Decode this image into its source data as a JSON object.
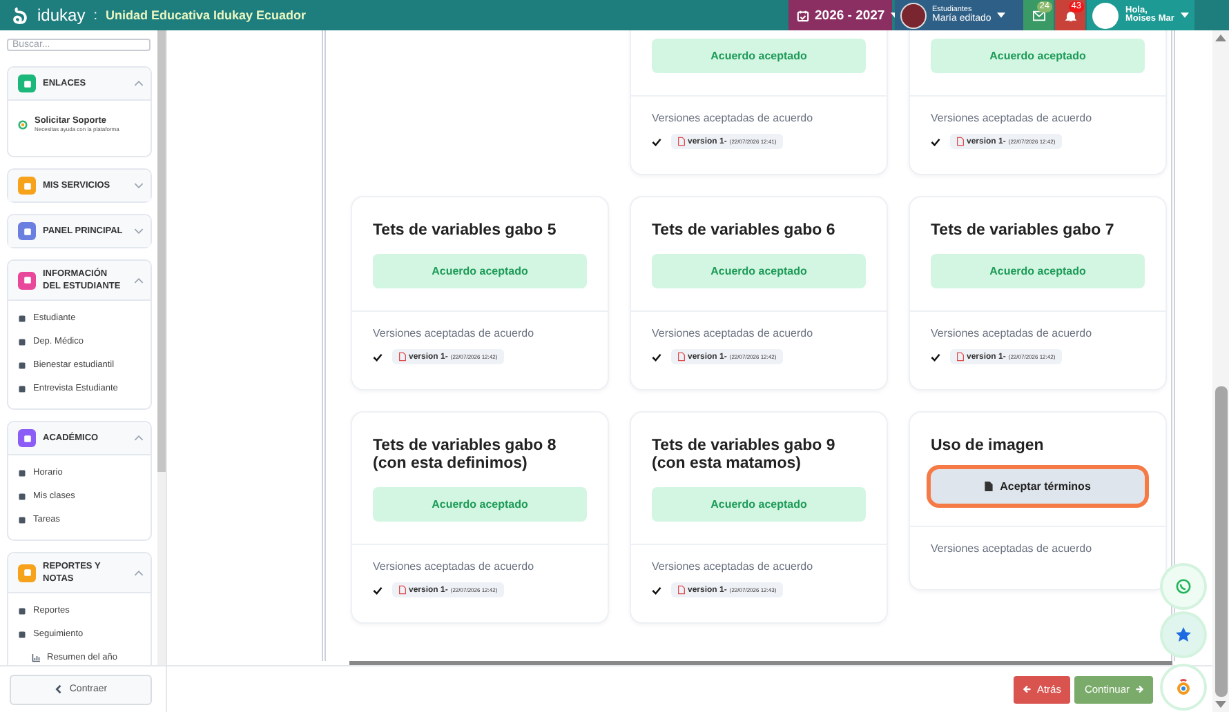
{
  "topbar": {
    "brand": "idukay",
    "separator": ":",
    "school": "Unidad Educativa Idukay Ecuador",
    "year": "2026 - 2027",
    "profile": {
      "role": "Estudiantes",
      "name": "María editado"
    },
    "messages_count": "24",
    "notifications_count": "43",
    "greeting": "Hola,",
    "user": "Moises Mar"
  },
  "sidebar": {
    "search_placeholder": "Buscar...",
    "sections": [
      {
        "title": "ENLACES",
        "color": "#1cb77a",
        "expanded": true,
        "items": [
          {
            "label": "Solicitar Soporte",
            "description": "Necesitas ayuda con la plataforma"
          }
        ]
      },
      {
        "title": "MIS SERVICIOS",
        "color": "#f7a21b",
        "expanded": false
      },
      {
        "title": "PANEL PRINCIPAL",
        "color": "#6a7fe0",
        "expanded": false
      },
      {
        "title": "INFORMACIÓN DEL ESTUDIANTE",
        "color": "#e8479a",
        "expanded": true,
        "items": [
          {
            "label": "Estudiante"
          },
          {
            "label": "Dep. Médico"
          },
          {
            "label": "Bienestar estudiantil"
          },
          {
            "label": "Entrevista Estudiante"
          }
        ]
      },
      {
        "title": "ACADÉMICO",
        "color": "#8b5cf6",
        "expanded": true,
        "items": [
          {
            "label": "Horario"
          },
          {
            "label": "Mis clases"
          },
          {
            "label": "Tareas"
          }
        ]
      },
      {
        "title": "REPORTES Y NOTAS",
        "color": "#f7a21b",
        "expanded": true,
        "items": [
          {
            "label": "Reportes"
          },
          {
            "label": "Seguimiento",
            "children": [
              {
                "label": "Resumen del año"
              }
            ]
          }
        ]
      }
    ],
    "collapse_label": "Contraer"
  },
  "cards": [
    {
      "action": {
        "kind": "accepted",
        "label": "Acuerdo aceptado"
      },
      "versions_label": "Versiones aceptadas de acuerdo",
      "versions": [
        {
          "label": "version 1-",
          "date": "(22/07/2026 12:41)"
        }
      ]
    },
    {
      "action": {
        "kind": "accepted",
        "label": "Acuerdo aceptado"
      },
      "versions_label": "Versiones aceptadas de acuerdo",
      "versions": [
        {
          "label": "version 1-",
          "date": "(22/07/2026 12:42)"
        }
      ]
    },
    {
      "title": "Tets de variables gabo 5",
      "action": {
        "kind": "accepted",
        "label": "Acuerdo aceptado"
      },
      "versions_label": "Versiones aceptadas de acuerdo",
      "versions": [
        {
          "label": "version 1-",
          "date": "(22/07/2026 12:42)"
        }
      ]
    },
    {
      "title": "Tets de variables gabo 6",
      "action": {
        "kind": "accepted",
        "label": "Acuerdo aceptado"
      },
      "versions_label": "Versiones aceptadas de acuerdo",
      "versions": [
        {
          "label": "version 1-",
          "date": "(22/07/2026 12:42)"
        }
      ]
    },
    {
      "title": "Tets de variables gabo 7",
      "action": {
        "kind": "accepted",
        "label": "Acuerdo aceptado"
      },
      "versions_label": "Versiones aceptadas de acuerdo",
      "versions": [
        {
          "label": "version 1-",
          "date": "(22/07/2026 12:42)"
        }
      ]
    },
    {
      "title": "Tets de variables gabo 8 (con esta definimos)",
      "action": {
        "kind": "accepted",
        "label": "Acuerdo aceptado"
      },
      "versions_label": "Versiones aceptadas de acuerdo",
      "versions": [
        {
          "label": "version 1-",
          "date": "(22/07/2026 12:42)"
        }
      ]
    },
    {
      "title": "Tets de variables gabo 9 (con esta matamos)",
      "action": {
        "kind": "accepted",
        "label": "Acuerdo aceptado"
      },
      "versions_label": "Versiones aceptadas de acuerdo",
      "versions": [
        {
          "label": "version 1-",
          "date": "(22/07/2026 12:43)"
        }
      ]
    },
    {
      "title": "Uso de imagen",
      "action": {
        "kind": "accept",
        "label": "Aceptar términos",
        "focused": true
      },
      "versions_label": "Versiones aceptadas de acuerdo"
    }
  ],
  "footer": {
    "back": "Atrás",
    "next": "Continuar"
  }
}
